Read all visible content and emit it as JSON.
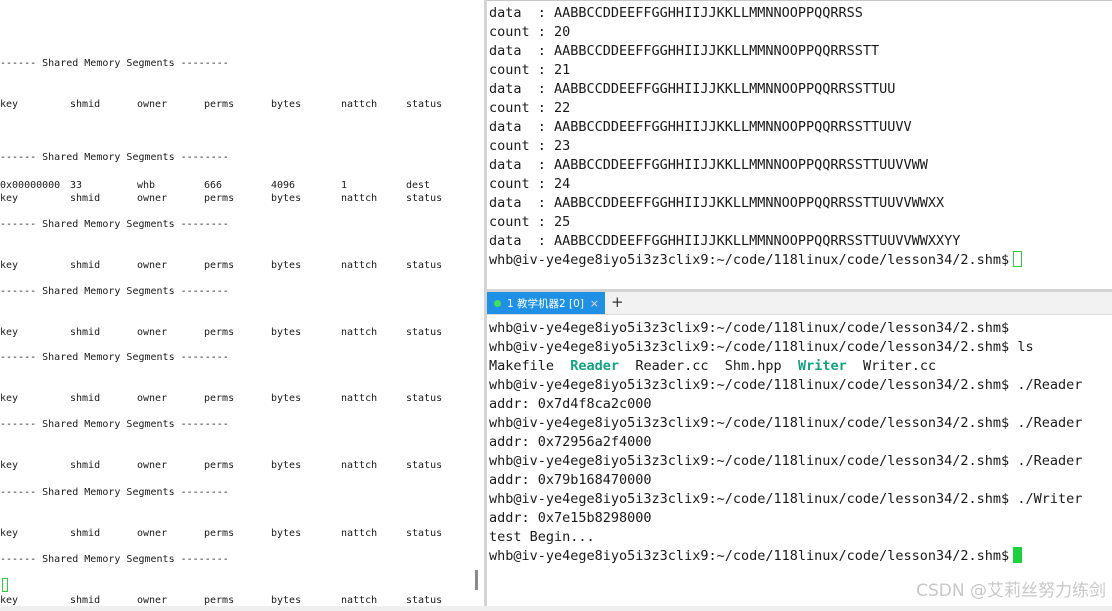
{
  "left_terminal": {
    "header": "------ Shared Memory Segments --------",
    "columns": [
      "key",
      "shmid",
      "owner",
      "perms",
      "bytes",
      "nattch",
      "status"
    ],
    "first_row": [
      "0x00000000",
      "33",
      "whb",
      "666",
      "4096",
      "1",
      "dest"
    ]
  },
  "top_terminal": {
    "lines": [
      "data  : AABBCCDDEEFFGGHHIIJJKKLLMMNNOOPPQQRRSS",
      "count : 20",
      "data  : AABBCCDDEEFFGGHHIIJJKKLLMMNNOOPPQQRRSSTT",
      "count : 21",
      "data  : AABBCCDDEEFFGGHHIIJJKKLLMMNNOOPPQQRRSSTTUU",
      "count : 22",
      "data  : AABBCCDDEEFFGGHHIIJJKKLLMMNNOOPPQQRRSSTTUUVV",
      "count : 23",
      "data  : AABBCCDDEEFFGGHHIIJJKKLLMMNNOOPPQQRRSSTTUUVVWW",
      "count : 24",
      "data  : AABBCCDDEEFFGGHHIIJJKKLLMMNNOOPPQQRRSSTTUUVVWWXX",
      "count : 25",
      "data  : AABBCCDDEEFFGGHHIIJJKKLLMMNNOOPPQQRRSSTTUUVVWWXXYY"
    ],
    "prompt": "whb@iv-ye4ege8iyo5i3z3clix9:~/code/118linux/code/lesson34/2.shm$"
  },
  "tab": {
    "label": "1 教学机器2 [0]",
    "close": "×",
    "add": "+"
  },
  "bottom_terminal": {
    "prompt": "whb@iv-ye4ege8iyo5i3z3clix9:~/code/118linux/code/lesson34/2.shm$",
    "cmd_ls": "ls",
    "ls_files": [
      "Makefile",
      "Reader",
      "Reader.cc",
      "Shm.hpp",
      "Writer",
      "Writer.cc"
    ],
    "cmd_reader": "./Reader",
    "cmd_writer": "./Writer",
    "addr1": "addr: 0x7d4f8ca2c000",
    "addr2": "addr: 0x72956a2f4000",
    "addr3": "addr: 0x79b168470000",
    "addr4": "addr: 0x7e15b8298000",
    "test": "test Begin..."
  },
  "watermark": "CSDN @艾莉丝努力练剑",
  "colors": {
    "executable": "#11a37f",
    "cursor": "#19d23c",
    "tab_active": "#1e90e6"
  }
}
